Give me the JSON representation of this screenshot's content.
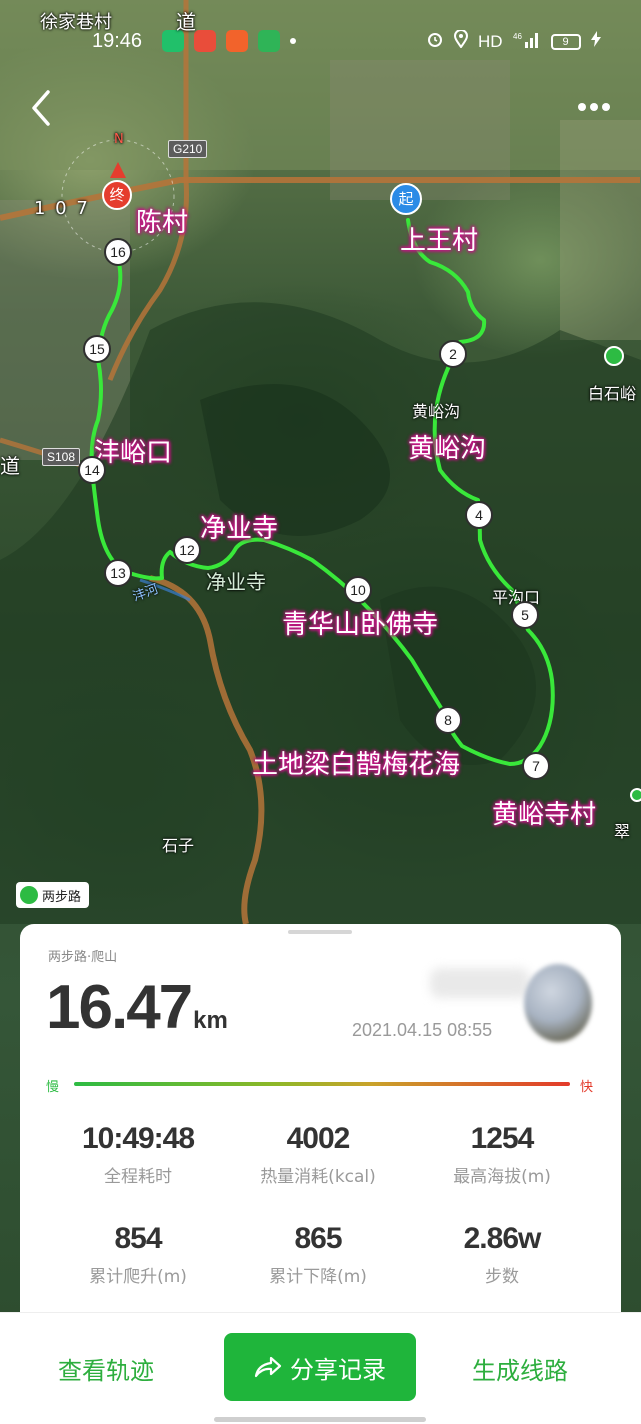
{
  "status_bar": {
    "time": "19:46",
    "network": "HD",
    "signal": "46",
    "battery": "9",
    "icons": [
      "app-icon-green",
      "weibo-icon",
      "app-icon-orange",
      "video-app-icon",
      "dot-icon",
      "alarm-icon",
      "location-icon",
      "signal-icon",
      "battery-icon"
    ]
  },
  "nav": {
    "back_icon": "chevron-left-icon",
    "more_icon": "more-dots-icon"
  },
  "map": {
    "place_labels": {
      "chencun": "陈村",
      "shangwangcun": "上王村",
      "fengyukou": "沣峪口",
      "huangyugou": "黄峪沟",
      "jingyesi": "净业寺",
      "qinghuashan": "青华山卧佛寺",
      "tudiliang": "土地梁白鹊梅花海",
      "huangyusicun": "黄峪寺村"
    },
    "basemap_labels": {
      "xujiaxiangcun": "徐家巷村",
      "huangyugou_small": "黄峪沟",
      "baishiyu": "白石峪",
      "pinggoukou": "平沟口",
      "jingyesi_small": "净业寺",
      "feng_river": "沣河",
      "shizi": "石子",
      "cui": "翠",
      "dao": "道",
      "dao2": "道",
      "road_107": "1 0 7",
      "compass_n": "N"
    },
    "road_badges": {
      "g210": "G210",
      "s108": "S108"
    },
    "start_label": "起",
    "end_label": "终",
    "km_markers": {
      "m2": "2",
      "m4": "4",
      "m5": "5",
      "m7": "7",
      "m8": "8",
      "m10": "10",
      "m12": "12",
      "m13": "13",
      "m14": "14",
      "m15": "15",
      "m16": "16"
    },
    "watermark": "两步路",
    "colors": {
      "track": "#39e83a",
      "road": "#b5743a",
      "place_glow": "#d0188f"
    }
  },
  "card": {
    "app_tag": "两步路·爬山",
    "distance": "16.47",
    "distance_unit": "km",
    "date": "2021.04.15 08:55",
    "pace_slow": "慢",
    "pace_fast": "快",
    "stats": [
      {
        "value": "10:49:48",
        "label": "全程耗时"
      },
      {
        "value": "4002",
        "label": "热量消耗(kcal)"
      },
      {
        "value": "1254",
        "label": "最高海拔(m)"
      },
      {
        "value": "854",
        "label": "累计爬升(m)"
      },
      {
        "value": "865",
        "label": "累计下降(m)"
      },
      {
        "value": "2.86w",
        "label": "步数"
      }
    ]
  },
  "actions": {
    "view_track": "查看轨迹",
    "share": "分享记录",
    "generate_route": "生成线路",
    "share_icon": "share-arrow-icon"
  }
}
